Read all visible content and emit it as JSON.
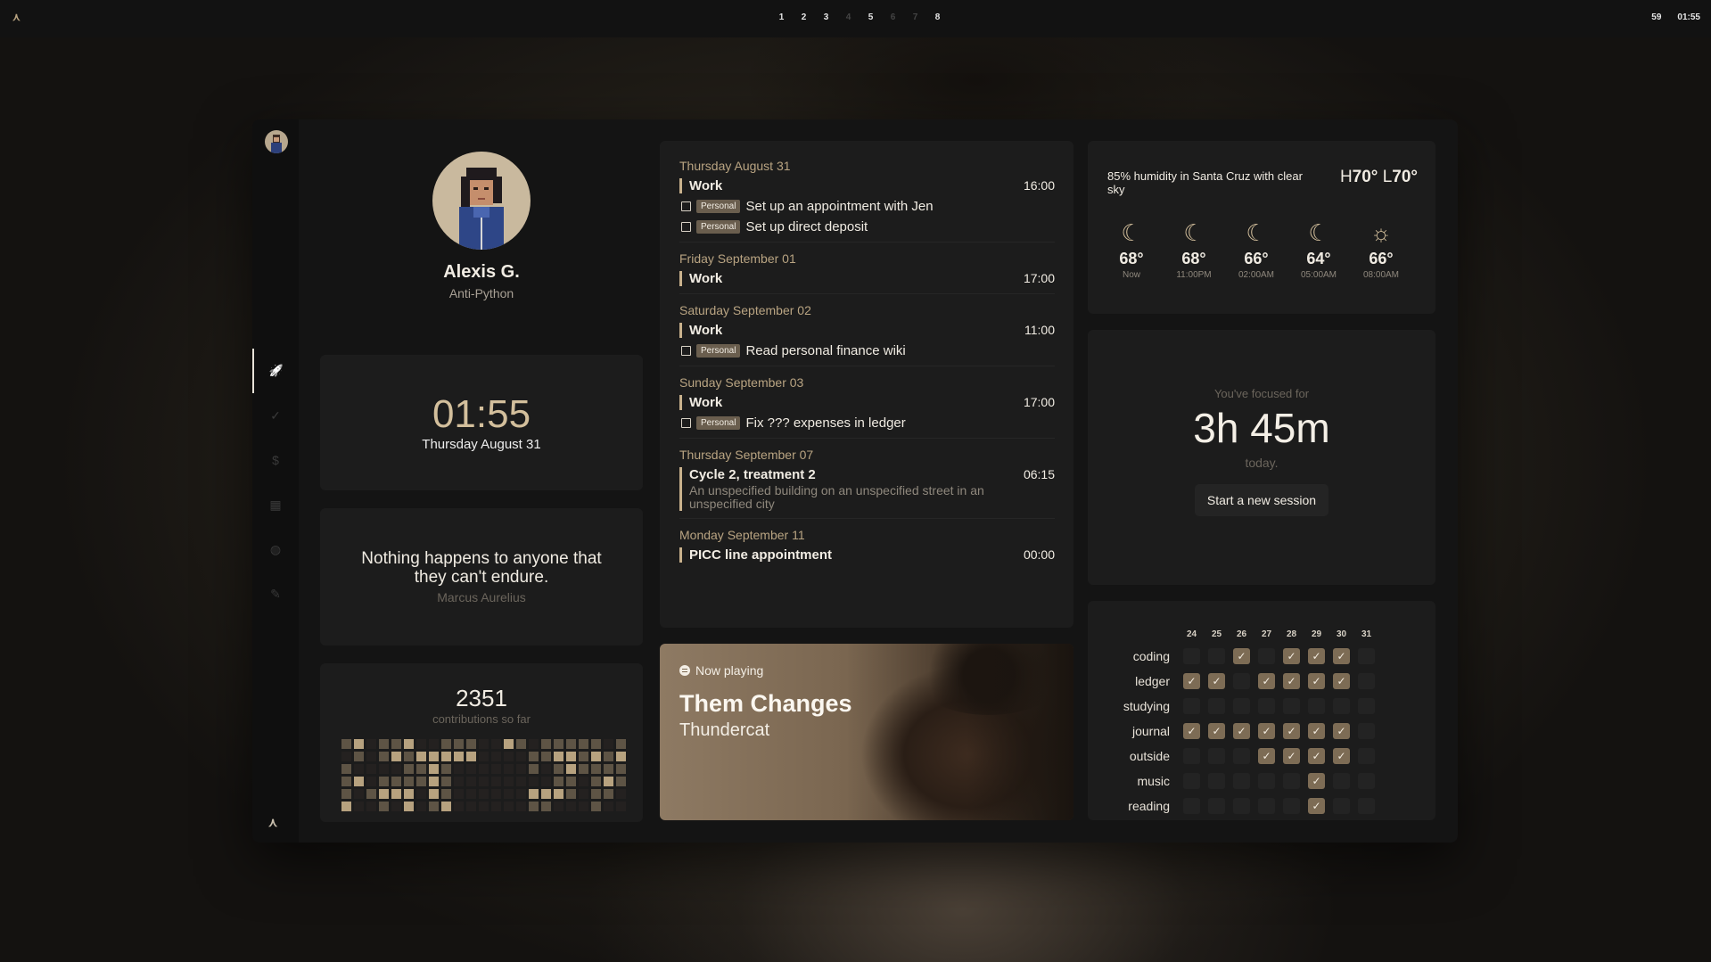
{
  "topbar": {
    "logo": "⋏",
    "workspaces": [
      {
        "label": "1",
        "active": true
      },
      {
        "label": "2",
        "active": true
      },
      {
        "label": "3",
        "active": true
      },
      {
        "label": "4",
        "active": false
      },
      {
        "label": "5",
        "active": true
      },
      {
        "label": "6",
        "active": false
      },
      {
        "label": "7",
        "active": false
      },
      {
        "label": "8",
        "active": true
      }
    ],
    "tray_volume": "59",
    "tray_time": "01:55"
  },
  "sidebar": {
    "logo": "⋏",
    "items": [
      {
        "name": "rocket-icon",
        "glyph": "🚀",
        "active": true
      },
      {
        "name": "check-icon",
        "glyph": "✓",
        "active": false
      },
      {
        "name": "dollar-icon",
        "glyph": "$",
        "active": false
      },
      {
        "name": "calendar-icon",
        "glyph": "▦",
        "active": false
      },
      {
        "name": "globe-icon",
        "glyph": "◍",
        "active": false
      },
      {
        "name": "wrench-icon",
        "glyph": "✎",
        "active": false
      }
    ]
  },
  "profile": {
    "name": "Alexis G.",
    "role": "Anti-Python"
  },
  "clock": {
    "time": "01:55",
    "date": "Thursday August 31"
  },
  "quote": {
    "text": "Nothing happens to anyone that they can't endure.",
    "author": "Marcus Aurelius"
  },
  "contributions": {
    "count": "2351",
    "label": "contributions so far"
  },
  "agenda": {
    "days": [
      {
        "date": "Thursday August 31",
        "events": [
          {
            "title": "Work",
            "time": "16:00",
            "sub": ""
          }
        ],
        "tasks": [
          {
            "tag": "Personal",
            "text": "Set up an appointment with Jen"
          },
          {
            "tag": "Personal",
            "text": "Set up direct deposit"
          }
        ]
      },
      {
        "date": "Friday September 01",
        "events": [
          {
            "title": "Work",
            "time": "17:00",
            "sub": ""
          }
        ],
        "tasks": []
      },
      {
        "date": "Saturday September 02",
        "events": [
          {
            "title": "Work",
            "time": "11:00",
            "sub": ""
          }
        ],
        "tasks": [
          {
            "tag": "Personal",
            "text": "Read personal finance wiki"
          }
        ]
      },
      {
        "date": "Sunday September 03",
        "events": [
          {
            "title": "Work",
            "time": "17:00",
            "sub": ""
          }
        ],
        "tasks": [
          {
            "tag": "Personal",
            "text": "Fix ??? expenses in ledger"
          }
        ]
      },
      {
        "date": "Thursday September 07",
        "events": [
          {
            "title": "Cycle 2, treatment 2",
            "time": "06:15",
            "sub": "An unspecified building on an unspecified street in an unspecified city"
          }
        ],
        "tasks": []
      },
      {
        "date": "Monday September 11",
        "events": [
          {
            "title": "PICC line appointment",
            "time": "00:00",
            "sub": ""
          }
        ],
        "tasks": []
      }
    ]
  },
  "now_playing": {
    "label": "Now playing",
    "song": "Them Changes",
    "artist": "Thundercat"
  },
  "weather": {
    "summary": "85% humidity in Santa Cruz with clear sky",
    "high_label": "H",
    "high": "70°",
    "low_label": "L",
    "low": "70°",
    "forecast": [
      {
        "temp": "68°",
        "time": "Now",
        "icon": "moon-icon"
      },
      {
        "temp": "68°",
        "time": "11:00PM",
        "icon": "moon-icon"
      },
      {
        "temp": "66°",
        "time": "02:00AM",
        "icon": "moon-icon"
      },
      {
        "temp": "64°",
        "time": "05:00AM",
        "icon": "moon-icon"
      },
      {
        "temp": "66°",
        "time": "08:00AM",
        "icon": "sun-icon"
      }
    ]
  },
  "focus": {
    "pre": "You've focused for",
    "duration": "3h 45m",
    "post": "today.",
    "button": "Start a new session"
  },
  "habits": {
    "days": [
      "24",
      "25",
      "26",
      "27",
      "28",
      "29",
      "30",
      "31"
    ],
    "rows": [
      {
        "name": "coding",
        "checks": [
          false,
          false,
          true,
          false,
          true,
          true,
          true,
          false
        ]
      },
      {
        "name": "ledger",
        "checks": [
          true,
          true,
          false,
          true,
          true,
          true,
          true,
          false
        ]
      },
      {
        "name": "studying",
        "checks": [
          false,
          false,
          false,
          false,
          false,
          false,
          false,
          false
        ]
      },
      {
        "name": "journal",
        "checks": [
          true,
          true,
          true,
          true,
          true,
          true,
          true,
          false
        ]
      },
      {
        "name": "outside",
        "checks": [
          false,
          false,
          false,
          true,
          true,
          true,
          true,
          false
        ]
      },
      {
        "name": "music",
        "checks": [
          false,
          false,
          false,
          false,
          false,
          true,
          false,
          false
        ]
      },
      {
        "name": "reading",
        "checks": [
          false,
          false,
          false,
          false,
          false,
          true,
          false,
          false
        ]
      }
    ]
  },
  "colors": {
    "accent": "#b9a482",
    "check_on": "#7d6c55",
    "panel": "#141414",
    "card": "#1c1c1c"
  }
}
